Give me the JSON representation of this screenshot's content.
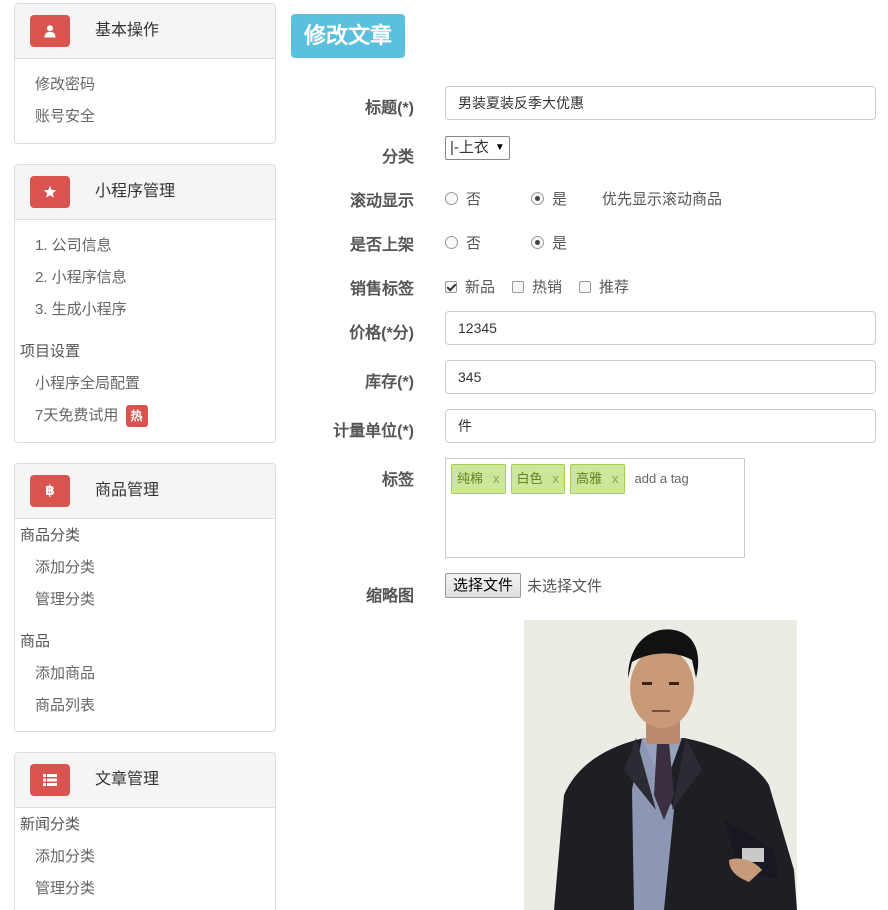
{
  "sidebar": {
    "basic": {
      "title": "基本操作",
      "items": [
        "修改密码",
        "账号安全"
      ]
    },
    "miniapp": {
      "title": "小程序管理",
      "items": [
        "1. 公司信息",
        "2. 小程序信息",
        "3. 生成小程序"
      ],
      "group": "项目设置",
      "group_items": [
        "小程序全局配置",
        "7天免费试用"
      ],
      "hot_badge": "热"
    },
    "goods": {
      "title": "商品管理",
      "group1": "商品分类",
      "group1_items": [
        "添加分类",
        "管理分类"
      ],
      "group2": "商品",
      "group2_items": [
        "添加商品",
        "商品列表"
      ]
    },
    "articles": {
      "title": "文章管理",
      "group": "新闻分类",
      "items": [
        "添加分类",
        "管理分类"
      ]
    }
  },
  "page_title": "修改文章",
  "form": {
    "title_label": "标题(*)",
    "title_value": "男装夏装反季大优惠",
    "category_label": "分类",
    "category_value": "|-上衣",
    "scroll_label": "滚动显示",
    "scroll_options": [
      "否",
      "是"
    ],
    "scroll_selected": "是",
    "scroll_hint": "优先显示滚动商品",
    "shelf_label": "是否上架",
    "shelf_options": [
      "否",
      "是"
    ],
    "shelf_selected": "是",
    "sales_label": "销售标签",
    "sales_options": [
      "新品",
      "热销",
      "推荐"
    ],
    "sales_checked": [
      "新品"
    ],
    "price_label": "价格(*分)",
    "price_value": "12345",
    "stock_label": "库存(*)",
    "stock_value": "345",
    "unit_label": "计量单位(*)",
    "unit_value": "件",
    "tags_label": "标签",
    "tags": [
      "纯棉",
      "白色",
      "高雅"
    ],
    "tag_remove": "x",
    "tags_placeholder": "add a tag",
    "thumb_label": "缩略图",
    "file_button": "选择文件",
    "file_status": "未选择文件"
  },
  "colors": {
    "accent_red": "#d9534f",
    "title_badge": "#5bc0de",
    "tag_bg": "#cde69c",
    "tag_border": "#a5d24a",
    "tag_text": "#638421"
  },
  "icons": {
    "basic": "user-icon",
    "miniapp": "star-icon",
    "goods": "bitcoin-icon",
    "articles": "list-icon"
  }
}
